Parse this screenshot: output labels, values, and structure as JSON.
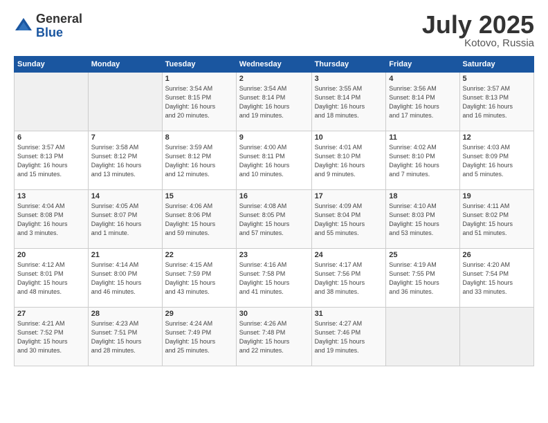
{
  "logo": {
    "general": "General",
    "blue": "Blue"
  },
  "title": {
    "month": "July 2025",
    "location": "Kotovo, Russia"
  },
  "headers": [
    "Sunday",
    "Monday",
    "Tuesday",
    "Wednesday",
    "Thursday",
    "Friday",
    "Saturday"
  ],
  "weeks": [
    [
      {
        "day": "",
        "info": ""
      },
      {
        "day": "",
        "info": ""
      },
      {
        "day": "1",
        "info": "Sunrise: 3:54 AM\nSunset: 8:15 PM\nDaylight: 16 hours\nand 20 minutes."
      },
      {
        "day": "2",
        "info": "Sunrise: 3:54 AM\nSunset: 8:14 PM\nDaylight: 16 hours\nand 19 minutes."
      },
      {
        "day": "3",
        "info": "Sunrise: 3:55 AM\nSunset: 8:14 PM\nDaylight: 16 hours\nand 18 minutes."
      },
      {
        "day": "4",
        "info": "Sunrise: 3:56 AM\nSunset: 8:14 PM\nDaylight: 16 hours\nand 17 minutes."
      },
      {
        "day": "5",
        "info": "Sunrise: 3:57 AM\nSunset: 8:13 PM\nDaylight: 16 hours\nand 16 minutes."
      }
    ],
    [
      {
        "day": "6",
        "info": "Sunrise: 3:57 AM\nSunset: 8:13 PM\nDaylight: 16 hours\nand 15 minutes."
      },
      {
        "day": "7",
        "info": "Sunrise: 3:58 AM\nSunset: 8:12 PM\nDaylight: 16 hours\nand 13 minutes."
      },
      {
        "day": "8",
        "info": "Sunrise: 3:59 AM\nSunset: 8:12 PM\nDaylight: 16 hours\nand 12 minutes."
      },
      {
        "day": "9",
        "info": "Sunrise: 4:00 AM\nSunset: 8:11 PM\nDaylight: 16 hours\nand 10 minutes."
      },
      {
        "day": "10",
        "info": "Sunrise: 4:01 AM\nSunset: 8:10 PM\nDaylight: 16 hours\nand 9 minutes."
      },
      {
        "day": "11",
        "info": "Sunrise: 4:02 AM\nSunset: 8:10 PM\nDaylight: 16 hours\nand 7 minutes."
      },
      {
        "day": "12",
        "info": "Sunrise: 4:03 AM\nSunset: 8:09 PM\nDaylight: 16 hours\nand 5 minutes."
      }
    ],
    [
      {
        "day": "13",
        "info": "Sunrise: 4:04 AM\nSunset: 8:08 PM\nDaylight: 16 hours\nand 3 minutes."
      },
      {
        "day": "14",
        "info": "Sunrise: 4:05 AM\nSunset: 8:07 PM\nDaylight: 16 hours\nand 1 minute."
      },
      {
        "day": "15",
        "info": "Sunrise: 4:06 AM\nSunset: 8:06 PM\nDaylight: 15 hours\nand 59 minutes."
      },
      {
        "day": "16",
        "info": "Sunrise: 4:08 AM\nSunset: 8:05 PM\nDaylight: 15 hours\nand 57 minutes."
      },
      {
        "day": "17",
        "info": "Sunrise: 4:09 AM\nSunset: 8:04 PM\nDaylight: 15 hours\nand 55 minutes."
      },
      {
        "day": "18",
        "info": "Sunrise: 4:10 AM\nSunset: 8:03 PM\nDaylight: 15 hours\nand 53 minutes."
      },
      {
        "day": "19",
        "info": "Sunrise: 4:11 AM\nSunset: 8:02 PM\nDaylight: 15 hours\nand 51 minutes."
      }
    ],
    [
      {
        "day": "20",
        "info": "Sunrise: 4:12 AM\nSunset: 8:01 PM\nDaylight: 15 hours\nand 48 minutes."
      },
      {
        "day": "21",
        "info": "Sunrise: 4:14 AM\nSunset: 8:00 PM\nDaylight: 15 hours\nand 46 minutes."
      },
      {
        "day": "22",
        "info": "Sunrise: 4:15 AM\nSunset: 7:59 PM\nDaylight: 15 hours\nand 43 minutes."
      },
      {
        "day": "23",
        "info": "Sunrise: 4:16 AM\nSunset: 7:58 PM\nDaylight: 15 hours\nand 41 minutes."
      },
      {
        "day": "24",
        "info": "Sunrise: 4:17 AM\nSunset: 7:56 PM\nDaylight: 15 hours\nand 38 minutes."
      },
      {
        "day": "25",
        "info": "Sunrise: 4:19 AM\nSunset: 7:55 PM\nDaylight: 15 hours\nand 36 minutes."
      },
      {
        "day": "26",
        "info": "Sunrise: 4:20 AM\nSunset: 7:54 PM\nDaylight: 15 hours\nand 33 minutes."
      }
    ],
    [
      {
        "day": "27",
        "info": "Sunrise: 4:21 AM\nSunset: 7:52 PM\nDaylight: 15 hours\nand 30 minutes."
      },
      {
        "day": "28",
        "info": "Sunrise: 4:23 AM\nSunset: 7:51 PM\nDaylight: 15 hours\nand 28 minutes."
      },
      {
        "day": "29",
        "info": "Sunrise: 4:24 AM\nSunset: 7:49 PM\nDaylight: 15 hours\nand 25 minutes."
      },
      {
        "day": "30",
        "info": "Sunrise: 4:26 AM\nSunset: 7:48 PM\nDaylight: 15 hours\nand 22 minutes."
      },
      {
        "day": "31",
        "info": "Sunrise: 4:27 AM\nSunset: 7:46 PM\nDaylight: 15 hours\nand 19 minutes."
      },
      {
        "day": "",
        "info": ""
      },
      {
        "day": "",
        "info": ""
      }
    ]
  ]
}
